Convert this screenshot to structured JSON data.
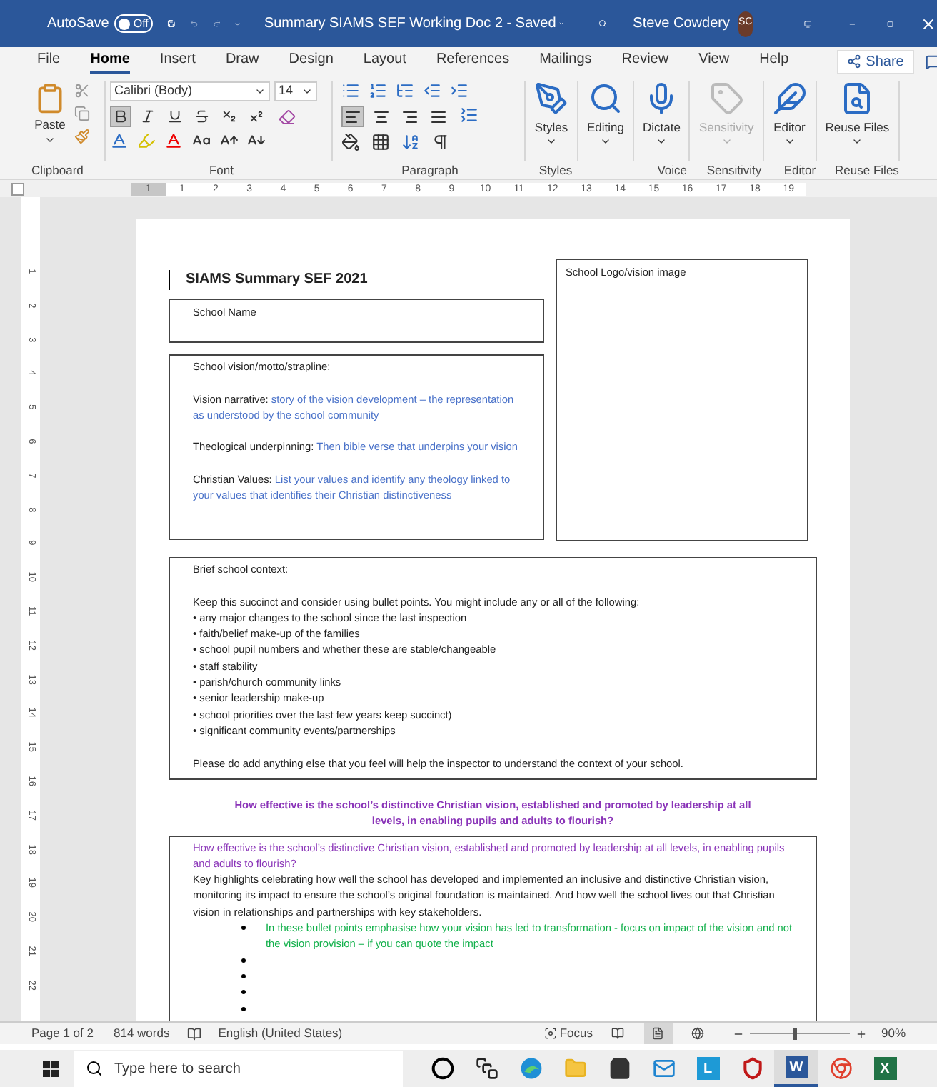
{
  "title_bar": {
    "autosave_label": "AutoSave",
    "autosave_toggle": {
      "label": "Off",
      "on": false
    },
    "title": "Summary SIAMS SEF Working Doc 2 - Saved",
    "user_name": "Steve Cowdery",
    "avatar_initials": "SC"
  },
  "tabs": [
    {
      "label": "File",
      "selected": false
    },
    {
      "label": "Home",
      "selected": true
    },
    {
      "label": "Insert",
      "selected": false
    },
    {
      "label": "Draw",
      "selected": false
    },
    {
      "label": "Design",
      "selected": false
    },
    {
      "label": "Layout",
      "selected": false
    },
    {
      "label": "References",
      "selected": false
    },
    {
      "label": "Mailings",
      "selected": false
    },
    {
      "label": "Review",
      "selected": false
    },
    {
      "label": "View",
      "selected": false
    },
    {
      "label": "Help",
      "selected": false
    }
  ],
  "share_button": "Share",
  "ribbon": {
    "paste_label": "Paste",
    "font_name": "Calibri (Body)",
    "font_size": "14",
    "format_buttons": [
      {
        "kind": "bold",
        "selected": true
      },
      {
        "kind": "italic",
        "selected": false
      },
      {
        "kind": "underline",
        "selected": false
      },
      {
        "kind": "strike",
        "selected": false
      },
      {
        "kind": "subscript",
        "selected": false
      },
      {
        "kind": "superscript",
        "selected": false
      }
    ],
    "alignments": [
      {
        "kind": "left",
        "selected": true
      },
      {
        "kind": "center",
        "selected": false
      },
      {
        "kind": "right",
        "selected": false
      },
      {
        "kind": "justify",
        "selected": false
      }
    ],
    "large_buttons": [
      {
        "kind": "styles",
        "label": "Styles",
        "disabled": false
      },
      {
        "kind": "editing",
        "label": "Editing",
        "disabled": false
      },
      {
        "kind": "dictate",
        "label": "Dictate",
        "disabled": false
      },
      {
        "kind": "sensitivity",
        "label": "Sensitivity",
        "disabled": true
      },
      {
        "kind": "editor",
        "label": "Editor",
        "disabled": false
      },
      {
        "kind": "reuse",
        "label": "Reuse Files",
        "disabled": false
      }
    ],
    "group_labels": [
      "Clipboard",
      "Font",
      "Paragraph",
      "Styles",
      "Voice",
      "Sensitivity",
      "Editor",
      "Reuse Files"
    ]
  },
  "ruler_labels": [
    "1",
    "1",
    "2",
    "3",
    "4",
    "5",
    "6",
    "7",
    "8",
    "9",
    "10",
    "11",
    "12",
    "13",
    "14",
    "15",
    "16",
    "17",
    "18",
    "19"
  ],
  "vertical_ruler_labels": [
    "1",
    "2",
    "3",
    "4",
    "5",
    "6",
    "7",
    "8",
    "9",
    "10",
    "11",
    "12",
    "13",
    "14",
    "15",
    "16",
    "17",
    "18",
    "19",
    "20",
    "21",
    "22"
  ],
  "document": {
    "title": "SIAMS Summary SEF 2021",
    "school_name_box": "School Name",
    "logo_box": "School Logo/vision image",
    "vision_box": {
      "heading": "School vision/motto/strapline:",
      "fields": [
        {
          "label": "Vision narrative:",
          "prompt": "story of the vision development – the representation as understood by the school community"
        },
        {
          "label": "Theological underpinning:",
          "prompt": "Then bible verse that underpins your vision"
        },
        {
          "label": "Christian Values:",
          "prompt": "List your values and identify any theology linked to your values that identifies their Christian distinctiveness"
        }
      ]
    },
    "context_box": {
      "heading": "Brief school context:",
      "intro": "Keep this succinct and consider using bullet points. You might include any or all of the following:",
      "bullets": [
        "• any major changes to the school since the last inspection",
        "• faith/belief make-up of the families",
        "• school pupil numbers and whether these are stable/changeable",
        "• staff stability",
        "• parish/church community links",
        "• senior leadership make-up",
        "• school priorities over the last few years keep succinct)",
        "• significant community events/partnerships"
      ],
      "closing": "Please do add anything else that you feel will help the inspector to understand the context of your school."
    },
    "question_heading": "How effective is the school’s distinctive Christian vision, established and promoted by leadership at all levels, in enabling pupils and adults to flourish?",
    "answer_box": {
      "question": "How effective is the school’s distinctive Christian vision, established and promoted by leadership at all levels, in enabling pupils and adults to flourish?",
      "paragraph": "Key highlights celebrating how well the school has developed and implemented an inclusive and distinctive Christian vision, monitoring its impact to ensure the school’s original foundation is maintained. And how well the school lives out that Christian vision in relationships and partnerships with key stakeholders.",
      "bullets": [
        {
          "kind": "prompt",
          "text": "In these bullet points emphasise how your vision has led to transformation - focus on impact of the vision and not the vision provision – if you can quote the impact"
        },
        {
          "kind": "empty"
        },
        {
          "kind": "empty"
        },
        {
          "kind": "empty"
        },
        {
          "kind": "empty"
        }
      ]
    }
  },
  "status_bar": {
    "page": "Page 1 of 2",
    "words": "814 words",
    "language": "English (United States)",
    "focus": "Focus",
    "views": [
      {
        "kind": "read",
        "selected": false
      },
      {
        "kind": "print",
        "selected": true
      },
      {
        "kind": "web",
        "selected": false
      }
    ],
    "zoom": {
      "level": 0.45
    },
    "zoom_reading": "90%"
  },
  "taskbar": {
    "search_placeholder": "Type here to search",
    "apps": [
      {
        "kind": "cortana",
        "selected": false
      },
      {
        "kind": "taskview",
        "selected": false
      },
      {
        "kind": "edge",
        "selected": false
      },
      {
        "kind": "folder",
        "selected": false
      },
      {
        "kind": "store",
        "selected": false
      },
      {
        "kind": "mail",
        "selected": false
      },
      {
        "kind": "letter",
        "letter": "L",
        "color": "#1e9ad6",
        "selected": false
      },
      {
        "kind": "shield",
        "selected": false
      },
      {
        "kind": "letter",
        "letter": "W",
        "color": "#2b579a",
        "selected": true
      },
      {
        "kind": "chrome",
        "selected": false
      },
      {
        "kind": "letter",
        "letter": "X",
        "color": "#217346",
        "selected": false
      }
    ]
  }
}
